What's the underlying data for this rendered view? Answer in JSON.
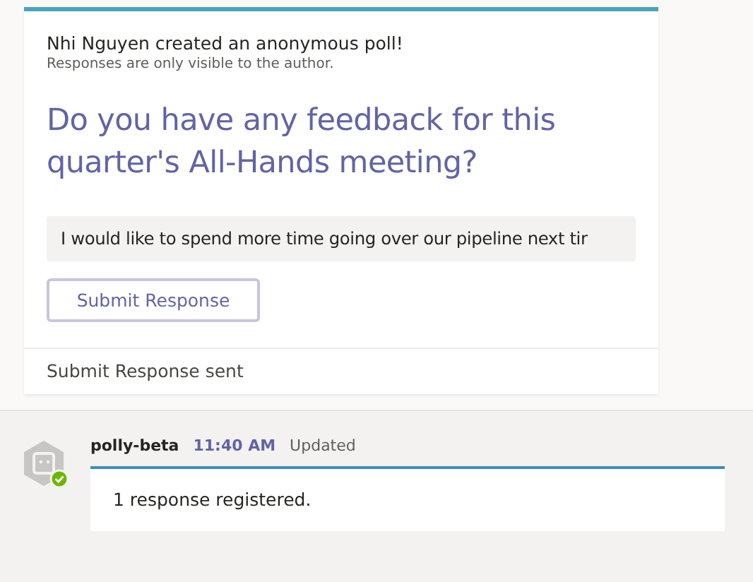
{
  "poll_card": {
    "header": "Nhi Nguyen created an anonymous poll!",
    "subheader": "Responses are only visible to the author.",
    "question": "Do you have any feedback for this quarter's All-Hands meeting?",
    "answer": {
      "value": "I would like to spend more time going over our pipeline next tir"
    },
    "submit_button": "Submit Response",
    "footer": "Submit Response sent"
  },
  "reply": {
    "sender": "polly-beta",
    "time": "11:40 AM",
    "status": "Updated",
    "message": "1 response registered."
  }
}
